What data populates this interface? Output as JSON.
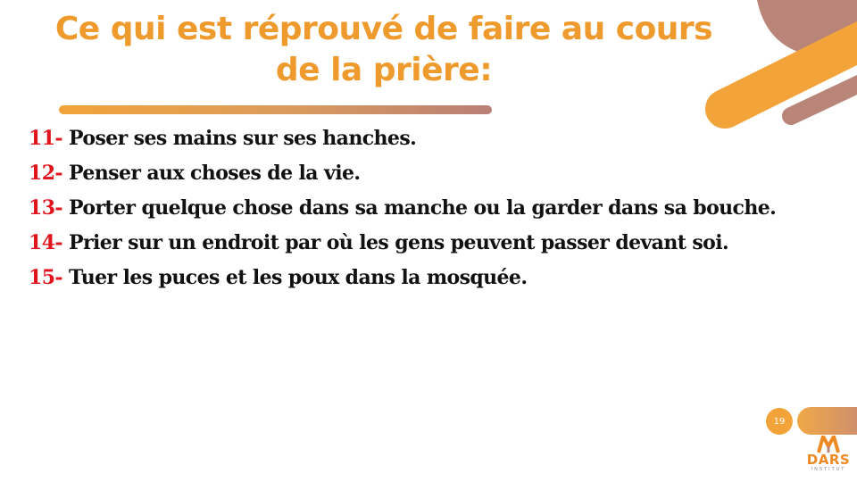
{
  "slide": {
    "title_line1": "Ce qui est réprouvé de faire au cours",
    "title_line2": "de la prière:",
    "items": [
      {
        "num": "11-",
        "text": " Poser ses mains sur ses hanches."
      },
      {
        "num": "12-",
        "text": " Penser aux choses de la vie."
      },
      {
        "num": "13-",
        "text": " Porter quelque chose dans sa manche ou la garder dans sa bouche."
      },
      {
        "num": "14-",
        "text": " Prier sur un endroit par où les gens peuvent passer devant soi."
      },
      {
        "num": "15-",
        "text": " Tuer les puces et les poux dans la mosquée."
      }
    ],
    "page_number": "19"
  },
  "logo": {
    "name": "DARS",
    "subtitle": "INSTITUT"
  },
  "colors": {
    "title": "#ee9a2c",
    "number": "#e0141c",
    "text": "#111111",
    "accent_orange": "#f2a43a",
    "accent_mauve": "#b98578"
  }
}
